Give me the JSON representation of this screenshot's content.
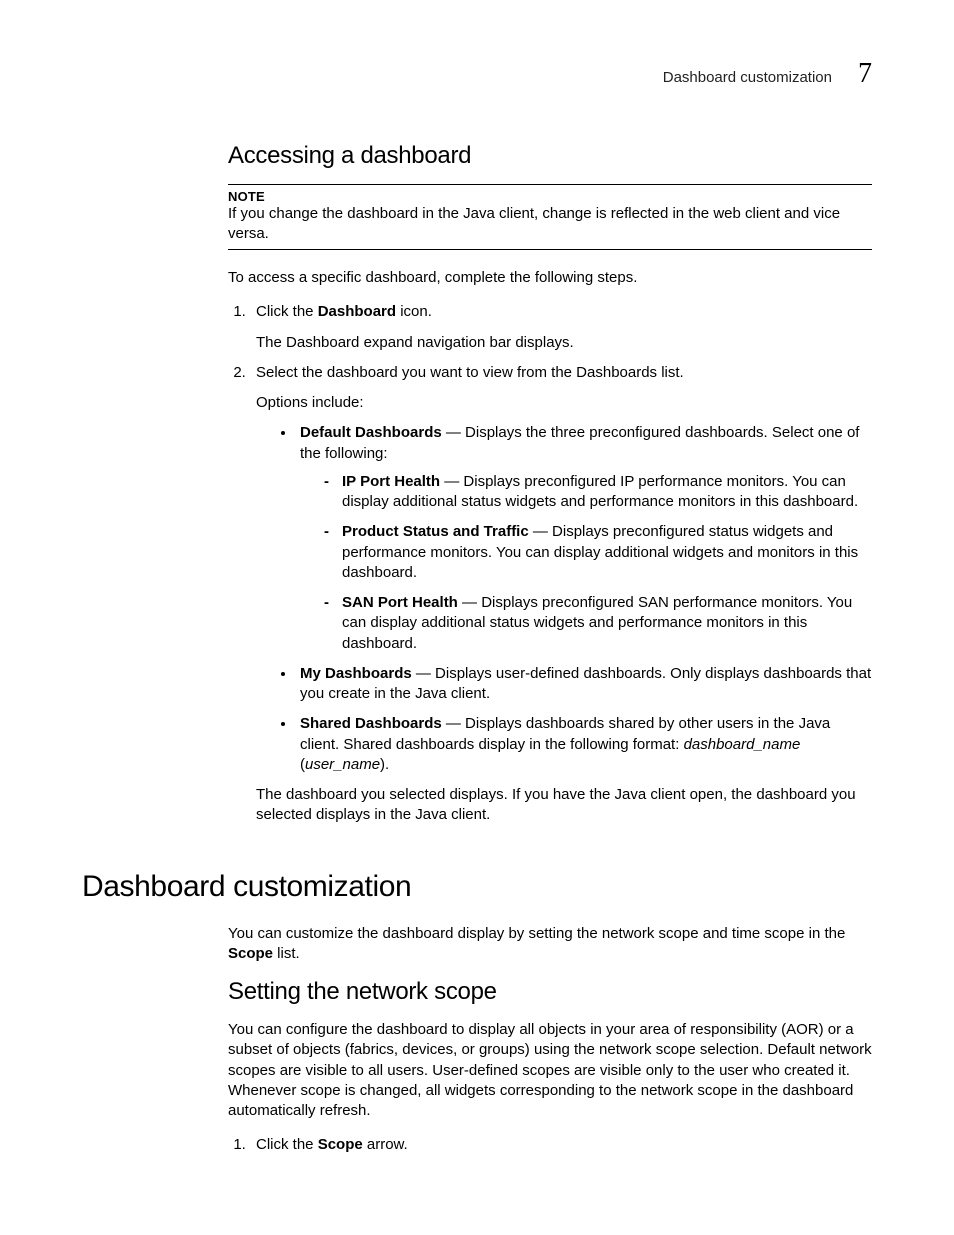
{
  "header": {
    "title": "Dashboard customization",
    "chapter": "7"
  },
  "section1": {
    "heading": "Accessing a dashboard",
    "note_label": "NOTE",
    "note_body": "If you change the dashboard in the Java client, change is reflected in the web client and vice versa.",
    "intro": "To access a specific dashboard, complete the following steps.",
    "step1_pre": "Click the ",
    "step1_bold": "Dashboard",
    "step1_post": " icon.",
    "step1_sub": "The Dashboard expand navigation bar displays.",
    "step2": "Select the dashboard you want to view from the Dashboards list.",
    "step2_sub": "Options include:",
    "bul1_bold": "Default Dashboards",
    "bul1_rest": " — Displays the three preconfigured dashboards. Select one of the following:",
    "dash1_bold": "IP Port Health",
    "dash1_rest": " — Displays preconfigured IP performance monitors. You can display additional status widgets and performance monitors in this dashboard.",
    "dash2_bold": "Product Status and Traffic",
    "dash2_rest": " — Displays preconfigured status widgets and performance monitors. You can display additional widgets and monitors in this dashboard.",
    "dash3_bold": "SAN Port Health",
    "dash3_rest": " — Displays preconfigured SAN performance monitors. You can display additional status widgets and performance monitors in this dashboard.",
    "bul2_bold": "My Dashboards",
    "bul2_rest": " — Displays user-defined dashboards. Only displays dashboards that you create in the Java client.",
    "bul3_bold": "Shared Dashboards",
    "bul3_rest_pre": " — Displays dashboards shared by other users in the Java client. Shared dashboards display in the following format: ",
    "bul3_it1": "dashboard_name",
    "bul3_mid": " (",
    "bul3_it2": "user_name",
    "bul3_end": ").",
    "step2_after": "The dashboard you selected displays. If you have the Java client open, the dashboard you selected displays in the Java client."
  },
  "section2": {
    "heading": "Dashboard customization",
    "para_pre": "You can customize the dashboard display by setting the network scope and time scope in the ",
    "para_bold": "Scope",
    "para_post": " list.",
    "sub_heading": "Setting the network scope",
    "sub_para": "You can configure the dashboard to display all objects in your area of responsibility (AOR) or a subset of objects (fabrics, devices, or groups) using the network scope selection. Default network scopes are visible to all users. User-defined scopes are visible only to the user who created it. Whenever scope is changed, all widgets corresponding to the network scope in the dashboard automatically refresh.",
    "step1_pre": "Click the ",
    "step1_bold": "Scope",
    "step1_post": " arrow."
  }
}
